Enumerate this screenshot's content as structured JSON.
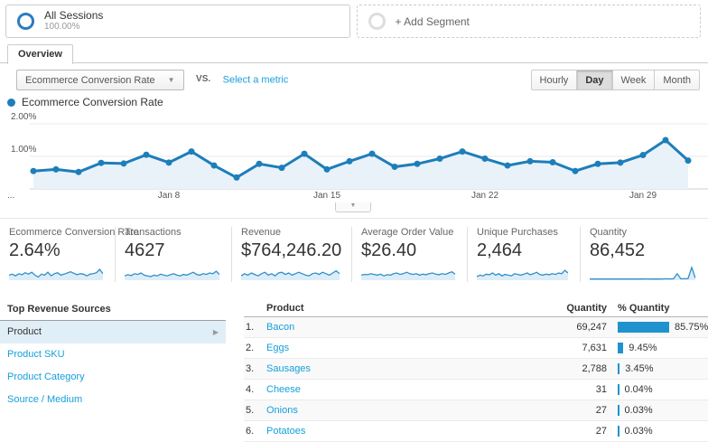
{
  "colors": {
    "line_blue": "#1d7eba",
    "fill_blue": "#e9f2f9",
    "spark_line": "#2f8fc9",
    "spark_fill": "#ddedf8",
    "bar_blue": "#2093ce",
    "link_blue": "#15a0da"
  },
  "segments": {
    "all_sessions": {
      "label": "All Sessions",
      "percent": "100.00%"
    },
    "add_label": "+ Add Segment"
  },
  "tabs": {
    "overview": "Overview"
  },
  "toolbar": {
    "metric_selected": "Ecommerce Conversion Rate",
    "vs_label": "VS.",
    "select_metric_label": "Select a metric",
    "granularity": {
      "options": [
        "Hourly",
        "Day",
        "Week",
        "Month"
      ],
      "active": "Day"
    }
  },
  "chart_data": {
    "type": "line",
    "title": "Ecommerce Conversion Rate",
    "unit": "%",
    "ylim": [
      0,
      2
    ],
    "y_tick_labels": [
      "2.00%",
      "1.00%"
    ],
    "x_tick_labels": [
      "...",
      "Jan 8",
      "Jan 15",
      "Jan 22",
      "Jan 29"
    ],
    "x_tick_indices": [
      -1,
      6,
      13,
      20,
      27
    ],
    "values": [
      0.55,
      0.6,
      0.52,
      0.8,
      0.78,
      1.05,
      0.81,
      1.15,
      0.72,
      0.35,
      0.77,
      0.65,
      1.08,
      0.6,
      0.85,
      1.08,
      0.68,
      0.77,
      0.93,
      1.15,
      0.93,
      0.72,
      0.85,
      0.82,
      0.55,
      0.77,
      0.81,
      1.04,
      1.5,
      0.87
    ],
    "grid": true,
    "legend_position": "top-left"
  },
  "scorecards": [
    {
      "label": "Ecommerce Conversion Rate",
      "value": "2.64%",
      "sparkline": [
        0.35,
        0.42,
        0.3,
        0.45,
        0.38,
        0.52,
        0.42,
        0.55,
        0.35,
        0.22,
        0.42,
        0.35,
        0.55,
        0.3,
        0.45,
        0.52,
        0.35,
        0.42,
        0.5,
        0.58,
        0.48,
        0.38,
        0.45,
        0.42,
        0.3,
        0.42,
        0.45,
        0.52,
        0.75,
        0.45
      ]
    },
    {
      "label": "Transactions",
      "value": "4627",
      "sparkline": [
        0.3,
        0.38,
        0.32,
        0.45,
        0.4,
        0.5,
        0.35,
        0.3,
        0.25,
        0.35,
        0.3,
        0.42,
        0.35,
        0.3,
        0.38,
        0.45,
        0.35,
        0.3,
        0.4,
        0.35,
        0.45,
        0.55,
        0.4,
        0.35,
        0.45,
        0.4,
        0.5,
        0.45,
        0.62,
        0.4
      ]
    },
    {
      "label": "Revenue",
      "value": "$764,246.20",
      "sparkline": [
        0.3,
        0.45,
        0.35,
        0.5,
        0.4,
        0.3,
        0.45,
        0.55,
        0.35,
        0.45,
        0.3,
        0.5,
        0.55,
        0.4,
        0.5,
        0.35,
        0.45,
        0.55,
        0.45,
        0.35,
        0.3,
        0.45,
        0.5,
        0.4,
        0.55,
        0.45,
        0.35,
        0.5,
        0.65,
        0.45
      ]
    },
    {
      "label": "Average Order Value",
      "value": "$26.40",
      "sparkline": [
        0.35,
        0.4,
        0.38,
        0.45,
        0.4,
        0.35,
        0.42,
        0.3,
        0.38,
        0.35,
        0.45,
        0.5,
        0.4,
        0.45,
        0.55,
        0.45,
        0.4,
        0.45,
        0.35,
        0.42,
        0.38,
        0.45,
        0.5,
        0.42,
        0.38,
        0.45,
        0.4,
        0.5,
        0.58,
        0.42
      ]
    },
    {
      "label": "Unique Purchases",
      "value": "2,464",
      "sparkline": [
        0.25,
        0.35,
        0.3,
        0.42,
        0.38,
        0.5,
        0.35,
        0.45,
        0.3,
        0.4,
        0.35,
        0.3,
        0.45,
        0.4,
        0.35,
        0.42,
        0.5,
        0.38,
        0.45,
        0.55,
        0.4,
        0.35,
        0.42,
        0.38,
        0.45,
        0.4,
        0.5,
        0.45,
        0.68,
        0.5
      ]
    },
    {
      "label": "Quantity",
      "value": "86,452",
      "sparkline": [
        0.08,
        0.08,
        0.08,
        0.09,
        0.08,
        0.09,
        0.08,
        0.08,
        0.09,
        0.08,
        0.09,
        0.08,
        0.08,
        0.09,
        0.08,
        0.09,
        0.09,
        0.08,
        0.09,
        0.08,
        0.09,
        0.1,
        0.09,
        0.1,
        0.45,
        0.1,
        0.1,
        0.12,
        0.88,
        0.14
      ]
    }
  ],
  "revenue_sources": {
    "title": "Top Revenue Sources",
    "items": [
      {
        "label": "Product",
        "selected": true
      },
      {
        "label": "Product SKU",
        "selected": false
      },
      {
        "label": "Product Category",
        "selected": false
      },
      {
        "label": "Source / Medium",
        "selected": false
      }
    ]
  },
  "product_table": {
    "columns": [
      "Product",
      "Quantity",
      "% Quantity"
    ],
    "rows": [
      {
        "rank": "1.",
        "product": "Bacon",
        "quantity": "69,247",
        "pct": "85.75%",
        "pct_value": 85.75
      },
      {
        "rank": "2.",
        "product": "Eggs",
        "quantity": "7,631",
        "pct": "9.45%",
        "pct_value": 9.45
      },
      {
        "rank": "3.",
        "product": "Sausages",
        "quantity": "2,788",
        "pct": "3.45%",
        "pct_value": 3.45
      },
      {
        "rank": "4.",
        "product": "Cheese",
        "quantity": "31",
        "pct": "0.04%",
        "pct_value": 0.04
      },
      {
        "rank": "5.",
        "product": "Onions",
        "quantity": "27",
        "pct": "0.03%",
        "pct_value": 0.03
      },
      {
        "rank": "6.",
        "product": "Potatoes",
        "quantity": "27",
        "pct": "0.03%",
        "pct_value": 0.03
      }
    ]
  }
}
